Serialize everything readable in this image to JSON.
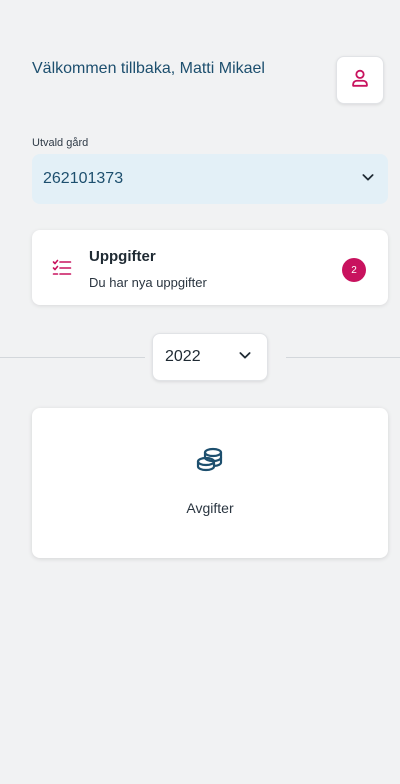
{
  "header": {
    "welcome_text": "Välkommen tillbaka, Matti Mikael",
    "profile_icon": "user-icon"
  },
  "farm_selector": {
    "label": "Utvald gård",
    "value": "262101373",
    "chevron_icon": "chevron-down-icon"
  },
  "tasks_card": {
    "icon": "checklist-icon",
    "title": "Uppgifter",
    "subtitle": "Du har nya uppgifter",
    "badge_count": "2"
  },
  "year_selector": {
    "value": "2022",
    "chevron_icon": "chevron-down-icon"
  },
  "fees_card": {
    "icon": "coins-icon",
    "label": "Avgifter"
  },
  "colors": {
    "accent": "#c8125e",
    "primary_text": "#1d4f6e",
    "select_bg": "#e3f0f7",
    "page_bg": "#f1f2f3"
  }
}
